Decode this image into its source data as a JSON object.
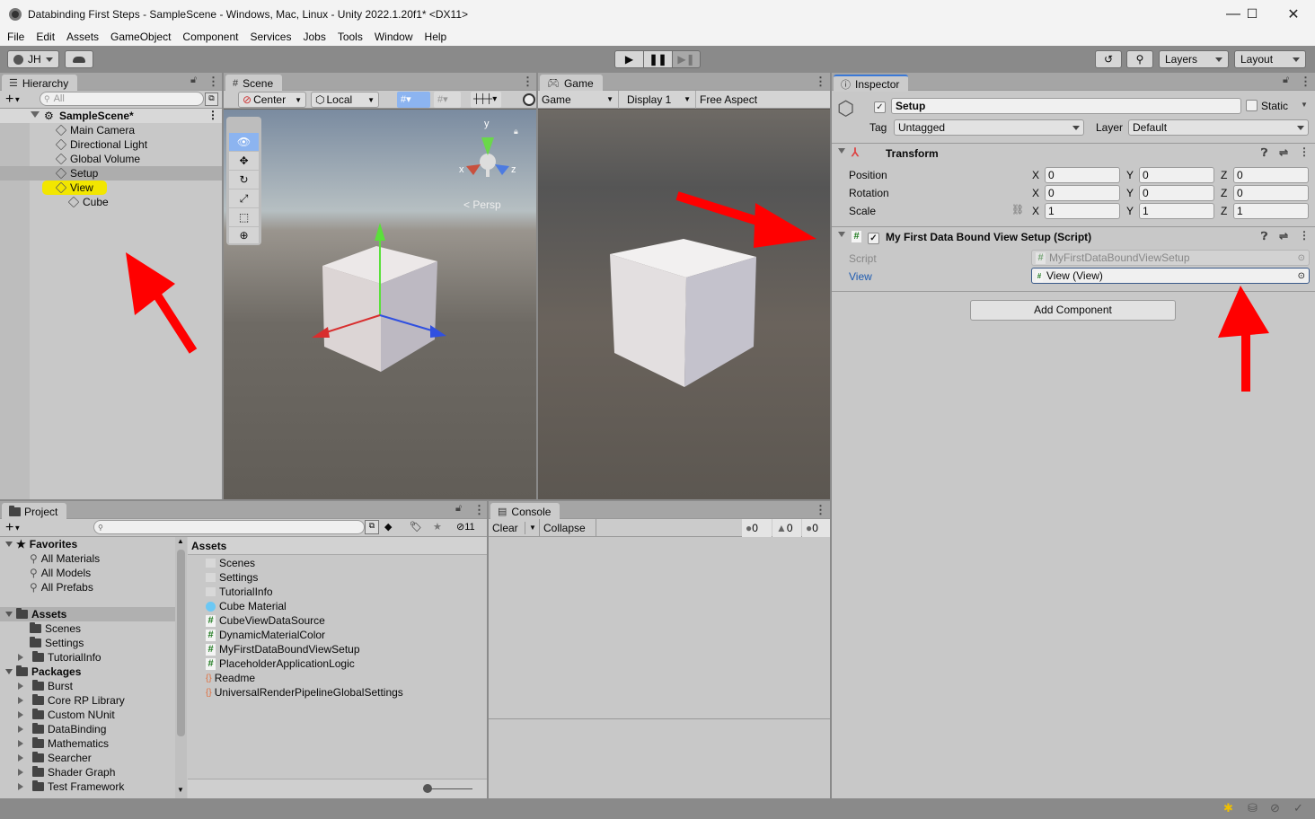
{
  "window": {
    "title": "Databinding First Steps - SampleScene - Windows, Mac, Linux - Unity 2022.1.20f1* <DX11>",
    "controls": [
      "minimize-icon",
      "maximize-icon",
      "close-icon"
    ]
  },
  "menu": [
    "File",
    "Edit",
    "Assets",
    "GameObject",
    "Component",
    "Services",
    "Jobs",
    "Tools",
    "Window",
    "Help"
  ],
  "toolbar": {
    "account": "JH",
    "play_controls": [
      "play-icon",
      "pause-icon",
      "step-icon"
    ],
    "layers": "Layers",
    "layout": "Layout"
  },
  "hierarchy": {
    "tab": "Hierarchy",
    "search_placeholder": "All",
    "scene": "SampleScene*",
    "items": [
      {
        "label": "Main Camera",
        "depth": 1
      },
      {
        "label": "Directional Light",
        "depth": 1
      },
      {
        "label": "Global Volume",
        "depth": 1
      },
      {
        "label": "Setup",
        "depth": 1,
        "selected": true
      },
      {
        "label": "View",
        "depth": 1,
        "highlighted": true
      },
      {
        "label": "Cube",
        "depth": 2
      }
    ]
  },
  "scene": {
    "tab": "Scene",
    "pivot": "Center",
    "space": "Local",
    "persp_label": "Persp",
    "gizmo_axes": [
      "x",
      "y",
      "z"
    ]
  },
  "game": {
    "tab": "Game",
    "mode": "Game",
    "display": "Display 1",
    "aspect": "Free Aspect"
  },
  "inspector": {
    "tab": "Inspector",
    "object_name": "Setup",
    "active": true,
    "static_label": "Static",
    "static": false,
    "tag_label": "Tag",
    "tag": "Untagged",
    "layer_label": "Layer",
    "layer": "Default",
    "transform": {
      "title": "Transform",
      "rows": [
        {
          "label": "Position",
          "x": "0",
          "y": "0",
          "z": "0"
        },
        {
          "label": "Rotation",
          "x": "0",
          "y": "0",
          "z": "0"
        },
        {
          "label": "Scale",
          "x": "1",
          "y": "1",
          "z": "1"
        }
      ]
    },
    "script_component": {
      "title": "My First Data Bound View Setup (Script)",
      "enabled": true,
      "script_label": "Script",
      "script_value": "MyFirstDataBoundViewSetup",
      "view_label": "View",
      "view_value": "View (View)"
    },
    "add_component": "Add Component"
  },
  "project": {
    "tab": "Project",
    "hidden_count": "11",
    "favorites_label": "Favorites",
    "favorites": [
      "All Materials",
      "All Models",
      "All Prefabs"
    ],
    "assets_label": "Assets",
    "asset_folders": [
      {
        "label": "Scenes",
        "expandable": false
      },
      {
        "label": "Settings",
        "expandable": false
      },
      {
        "label": "TutorialInfo",
        "expandable": true
      }
    ],
    "packages_label": "Packages",
    "packages": [
      "Burst",
      "Core RP Library",
      "Custom NUnit",
      "DataBinding",
      "Mathematics",
      "Searcher",
      "Shader Graph",
      "Test Framework"
    ],
    "content_header": "Assets",
    "content": [
      {
        "label": "Scenes",
        "icon": "folder-icon"
      },
      {
        "label": "Settings",
        "icon": "folder-icon"
      },
      {
        "label": "TutorialInfo",
        "icon": "folder-icon"
      },
      {
        "label": "Cube Material",
        "icon": "material-icon"
      },
      {
        "label": "CubeViewDataSource",
        "icon": "script-icon"
      },
      {
        "label": "DynamicMaterialColor",
        "icon": "script-icon"
      },
      {
        "label": "MyFirstDataBoundViewSetup",
        "icon": "script-icon"
      },
      {
        "label": "PlaceholderApplicationLogic",
        "icon": "script-icon"
      },
      {
        "label": "Readme",
        "icon": "asset-icon"
      },
      {
        "label": "UniversalRenderPipelineGlobalSettings",
        "icon": "asset-icon"
      }
    ]
  },
  "console": {
    "tab": "Console",
    "clear": "Clear",
    "collapse": "Collapse",
    "log_count": "0",
    "warning_count": "0",
    "error_count": "0"
  },
  "colors": {
    "highlight_yellow": "#f2e600",
    "annotation_red": "#ff0000",
    "selection_blue": "#8cb4f0"
  }
}
